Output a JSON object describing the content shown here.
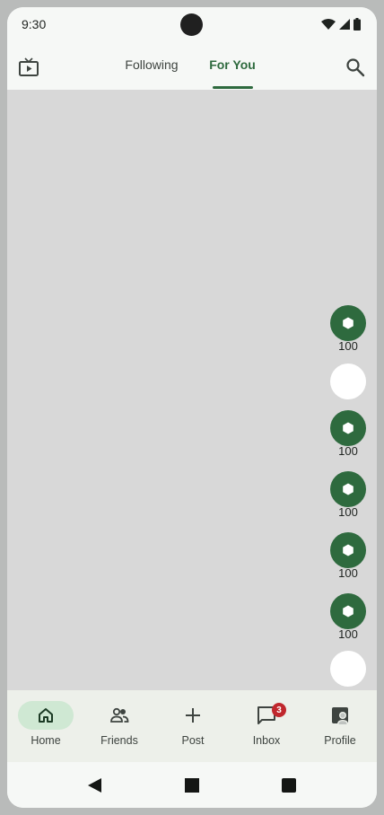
{
  "status_bar": {
    "time": "9:30",
    "icons": [
      "wifi-icon",
      "signal-icon",
      "battery-icon"
    ]
  },
  "top_bar": {
    "left_icon": "live-tv-icon",
    "tabs": [
      {
        "label": "Following",
        "active": false
      },
      {
        "label": "For You",
        "active": true
      }
    ],
    "right_icon": "search-icon"
  },
  "feed": {
    "actions": [
      {
        "type": "like",
        "icon": "hexagon-icon",
        "count": "100"
      },
      {
        "type": "blank",
        "icon": "",
        "count": ""
      },
      {
        "type": "comment",
        "icon": "hexagon-icon",
        "count": "100"
      },
      {
        "type": "save",
        "icon": "hexagon-icon",
        "count": "100"
      },
      {
        "type": "share",
        "icon": "hexagon-icon",
        "count": "100"
      },
      {
        "type": "repost",
        "icon": "hexagon-icon",
        "count": "100"
      },
      {
        "type": "blank",
        "icon": "",
        "count": ""
      }
    ]
  },
  "bottom_nav": {
    "items": [
      {
        "label": "Home",
        "icon": "home-icon",
        "active": true
      },
      {
        "label": "Friends",
        "icon": "people-icon",
        "active": false
      },
      {
        "label": "Post",
        "icon": "plus-icon",
        "active": false
      },
      {
        "label": "Inbox",
        "icon": "chat-icon",
        "active": false,
        "badge": "3"
      },
      {
        "label": "Profile",
        "icon": "profile-icon",
        "active": false
      }
    ]
  },
  "system_nav": {
    "buttons": [
      "back-icon",
      "home-square-icon",
      "recents-icon"
    ]
  },
  "colors": {
    "accent": "#2e6a3e",
    "feed_background": "#d8d8d8",
    "nav_active_pill": "#cfe8d3",
    "badge": "#c0272d"
  }
}
